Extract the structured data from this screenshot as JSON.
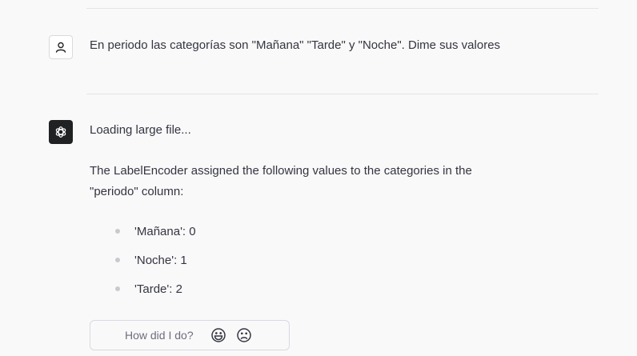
{
  "conversation": {
    "user_message": "En periodo las categorías son \"Mañana\" \"Tarde\" y \"Noche\". Dime sus valores",
    "assistant": {
      "status": "Loading large file...",
      "paragraph": "The LabelEncoder assigned the following values to the categories in the \"periodo\" column:",
      "list": [
        "'Mañana': 0",
        "'Noche': 1",
        "'Tarde': 2"
      ]
    }
  },
  "feedback": {
    "label": "How did I do?"
  },
  "icons": {
    "user_avatar": "user-icon",
    "assistant_avatar": "openai-logo-icon",
    "happy": "smiley-face-icon",
    "sad": "sad-face-icon"
  },
  "colors": {
    "background": "#f9f9f9",
    "text": "#343541",
    "assistant_avatar_bg": "#202123",
    "divider": "#e5e5e5"
  }
}
